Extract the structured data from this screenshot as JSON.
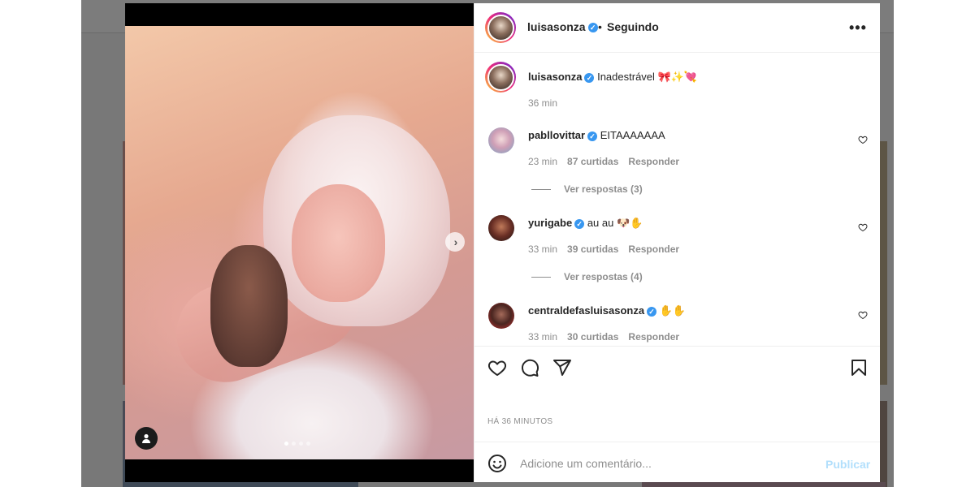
{
  "post": {
    "username": "luisasonza",
    "follow_separator": "•",
    "follow_status": "Seguindo",
    "caption": "Inadestrável 🎀✨💘",
    "caption_time": "36 min",
    "posted_ago": "HÁ 36 MINUTOS",
    "carousel": {
      "total": 4,
      "current": 1
    }
  },
  "comments": [
    {
      "username": "pabllovittar",
      "text": "EITAAAAAAA",
      "time": "23 min",
      "likes": "87 curtidas",
      "reply_label": "Responder",
      "view_replies": "Ver respostas (3)"
    },
    {
      "username": "yurigabe",
      "text": "au au 🐶✋",
      "time": "33 min",
      "likes": "39 curtidas",
      "reply_label": "Responder",
      "view_replies": "Ver respostas (4)"
    },
    {
      "username": "centraldefasluisasonza",
      "text": "✋✋",
      "time": "33 min",
      "likes": "30 curtidas",
      "reply_label": "Responder"
    }
  ],
  "add_comment": {
    "placeholder": "Adicione um comentário...",
    "publish_label": "Publicar"
  },
  "icons": {
    "like": "heart-icon",
    "comment": "comment-icon",
    "share": "paper-plane-icon",
    "save": "bookmark-icon",
    "emoji": "smiley-icon",
    "more": "more-options-icon",
    "next": "chevron-right-icon",
    "tag": "user-tag-icon"
  },
  "colors": {
    "verified": "#3897f0",
    "publish_disabled": "#b2dffc",
    "muted_text": "#8e8e8e"
  }
}
